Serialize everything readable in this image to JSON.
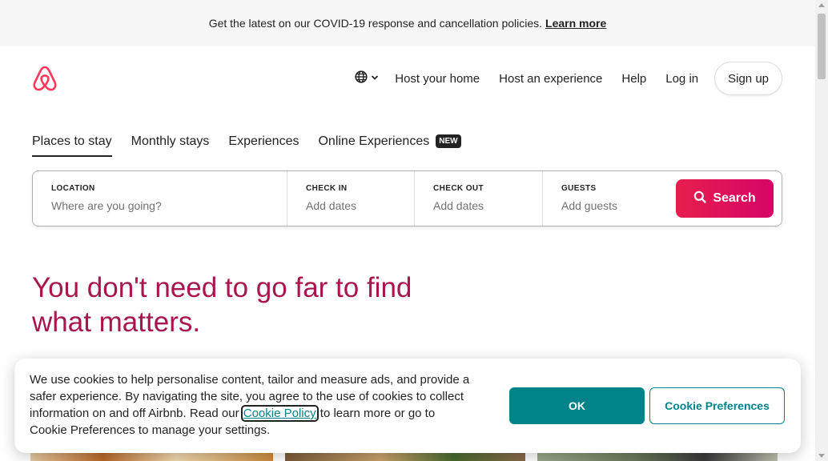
{
  "banner": {
    "text": "Get the latest on our COVID-19 response and cancellation policies.",
    "link": "Learn more"
  },
  "header": {
    "logo_icon": "airbnb-logo-icon",
    "language_icon": "globe-icon",
    "host_home": "Host your home",
    "host_experience": "Host an experience",
    "help": "Help",
    "login": "Log in",
    "signup": "Sign up"
  },
  "tabs": [
    {
      "label": "Places to stay",
      "active": true
    },
    {
      "label": "Monthly stays"
    },
    {
      "label": "Experiences"
    },
    {
      "label": "Online Experiences",
      "badge": "NEW"
    }
  ],
  "search": {
    "location": {
      "label": "LOCATION",
      "placeholder": "Where are you going?"
    },
    "checkin": {
      "label": "CHECK IN",
      "placeholder": "Add dates"
    },
    "checkout": {
      "label": "CHECK OUT",
      "placeholder": "Add dates"
    },
    "guests": {
      "label": "GUESTS",
      "placeholder": "Add guests"
    },
    "button": "Search",
    "button_icon": "search-icon"
  },
  "hero": {
    "title": "You don't need to go far to find what matters."
  },
  "cookie": {
    "text_before": "We use cookies to help personalise content, tailor and measure ads, and provide a safer experience. By navigating the site, you agree to the use of cookies to collect information on and off Airbnb. Read our",
    "link": "Cookie Policy",
    "text_after": "to learn more or go to Cookie Preferences to manage your settings.",
    "ok": "OK",
    "preferences": "Cookie Preferences"
  },
  "colors": {
    "brand": "#ff385c",
    "search_button": "#e61e4d",
    "hero_text": "#a8154f",
    "teal": "#008489"
  }
}
